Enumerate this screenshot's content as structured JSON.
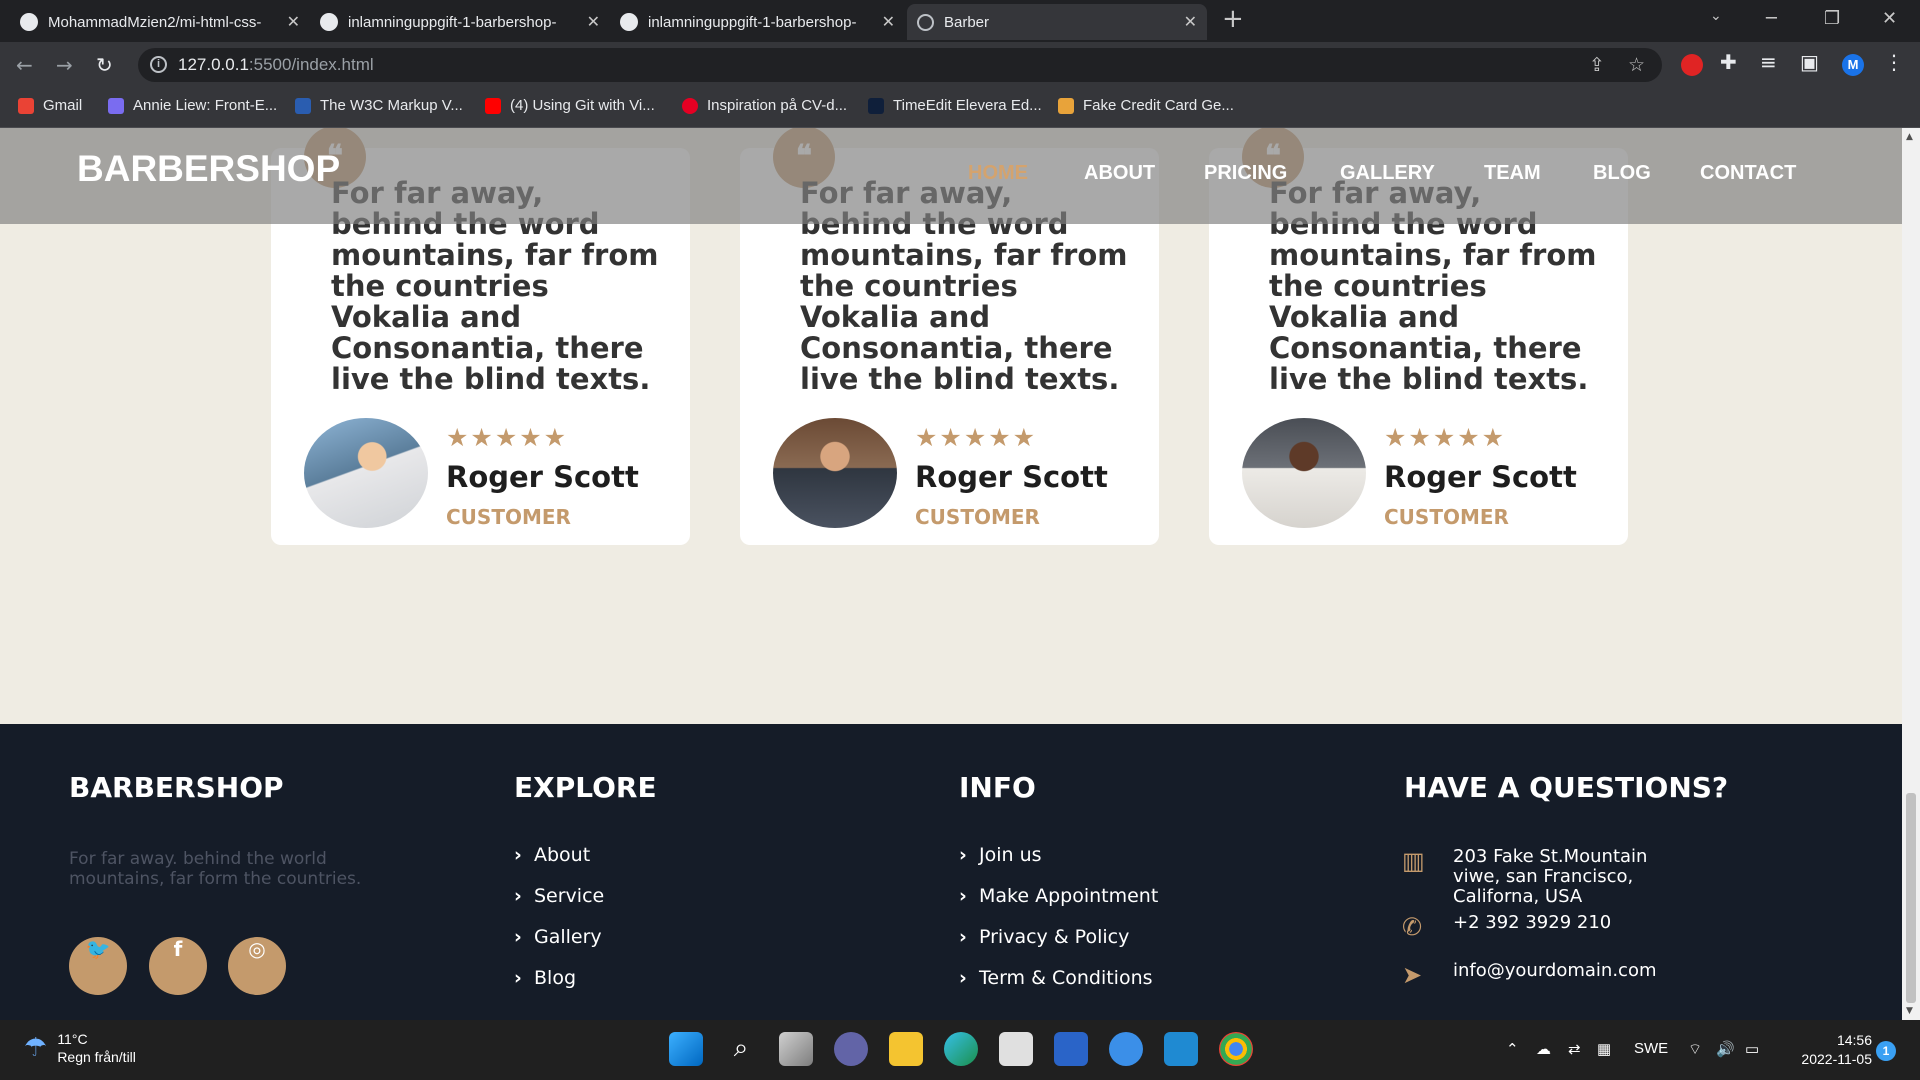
{
  "browser": {
    "tabs": [
      {
        "title": "MohammadMzien2/mi-html-css-",
        "close": "✕"
      },
      {
        "title": "inlamninguppgift-1-barbershop-",
        "close": "✕"
      },
      {
        "title": "inlamninguppgift-1-barbershop-",
        "close": "✕"
      },
      {
        "title": "Barber",
        "close": "✕"
      }
    ],
    "new_tab": "+",
    "address": {
      "host": "127.0.0.1",
      "path": ":5500/index.html"
    },
    "profile_initial": "M",
    "bookmarks": [
      {
        "label": "Gmail",
        "color": "#ea4335"
      },
      {
        "label": "Annie Liew: Front-E...",
        "color": "#7a6cf0"
      },
      {
        "label": "The W3C Markup V...",
        "color": "#2a5db0"
      },
      {
        "label": "(4) Using Git with Vi...",
        "color": "#ff0000"
      },
      {
        "label": "Inspiration på CV-d...",
        "color": "#e60023"
      },
      {
        "label": "TimeEdit Elevera Ed...",
        "color": "#0f1f3a"
      },
      {
        "label": "Fake Credit Card Ge...",
        "color": "#e8a33a"
      }
    ]
  },
  "site": {
    "logo": "BARBERSHOP",
    "menu": [
      "HOME",
      "ABOUT",
      "PRICING",
      "GALLERY",
      "TEAM",
      "BLOG",
      "CONTACT"
    ],
    "accent": "#c49a6c",
    "testimonials": [
      {
        "quote": "For far away, behind the word mountains, far from the countries Vokalia and Consonantia, there live the blind texts.",
        "rating": "★★★★★",
        "name": "Roger Scott",
        "role": "CUSTOMER"
      },
      {
        "quote": "For far away, behind the word mountains, far from the countries Vokalia and Consonantia, there live the blind texts.",
        "rating": "★★★★★",
        "name": "Roger Scott",
        "role": "CUSTOMER"
      },
      {
        "quote": "For far away, behind the word mountains, far from the countries Vokalia and Consonantia, there live the blind texts.",
        "rating": "★★★★★",
        "name": "Roger Scott",
        "role": "CUSTOMER"
      }
    ],
    "footer": {
      "brand": {
        "title": "BARBERSHOP",
        "text": "For far away. behind the world mountains, far form the countries."
      },
      "explore": {
        "title": "EXPLORE",
        "links": [
          "About",
          "Service",
          "Gallery",
          "Blog"
        ]
      },
      "info": {
        "title": "INFO",
        "links": [
          "Join us",
          "Make Appointment",
          "Privacy & Policy",
          "Term & Conditions"
        ]
      },
      "contact": {
        "title": "HAVE A QUESTIONS?",
        "address": "203 Fake St.Mountain viwe, san Francisco, Californa, USA",
        "phone": "+2 392 3929 210",
        "email": "info@yourdomain.com"
      }
    }
  },
  "taskbar": {
    "weather": {
      "temp": "11°C",
      "desc": "Regn från/till"
    },
    "language": "SWE",
    "time": "14:56",
    "date": "2022-11-05",
    "notifications": "1"
  }
}
